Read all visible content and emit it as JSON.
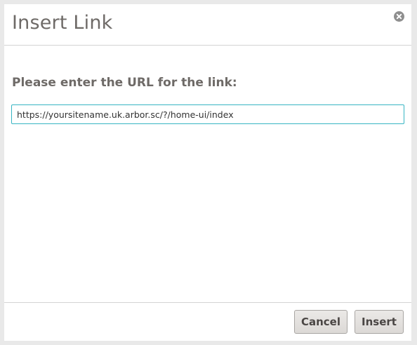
{
  "dialog": {
    "title": "Insert Link",
    "close_icon": "close-circle-icon",
    "prompt": "Please enter the URL for the link:",
    "url_value": "https://yoursitename.uk.arbor.sc/?/home-ui/index",
    "cancel_label": "Cancel",
    "insert_label": "Insert"
  },
  "colors": {
    "title_text": "#6e6a67",
    "input_border": "#37b5c3",
    "button_bg": "#dcd9d6"
  }
}
